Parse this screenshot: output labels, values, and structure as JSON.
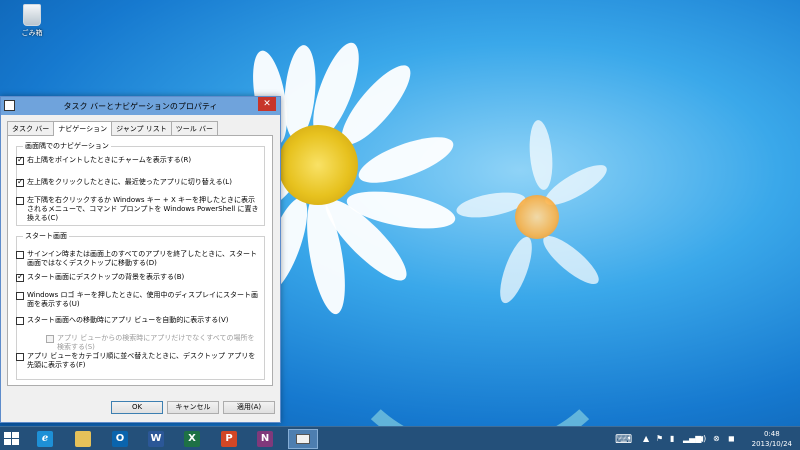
{
  "desktop": {
    "recycle_bin_label": "ごみ箱"
  },
  "dialog": {
    "title": "タスク バーとナビゲーションのプロパティ",
    "close_glyph": "✕",
    "tabs": [
      {
        "label": "タスク バー",
        "active": false
      },
      {
        "label": "ナビゲーション",
        "active": true
      },
      {
        "label": "ジャンプ リスト",
        "active": false
      },
      {
        "label": "ツール バー",
        "active": false
      }
    ],
    "corner_group": {
      "title": "画面隅でのナビゲーション",
      "options": [
        {
          "label": "右上隅をポイントしたときにチャームを表示する(R)",
          "checked": true
        },
        {
          "label": "左上隅をクリックしたときに、最近使ったアプリに切り替える(L)",
          "checked": true
        },
        {
          "label": "左下隅を右クリックするか Windows キー + X キーを押したときに表示されるメニューで、コマンド プロンプトを Windows PowerShell に置き換える(C)",
          "checked": false
        }
      ]
    },
    "start_group": {
      "title": "スタート画面",
      "options": [
        {
          "label": "サインイン時または画面上のすべてのアプリを終了したときに、スタート画面ではなくデスクトップに移動する(D)",
          "checked": false,
          "disabled": false
        },
        {
          "label": "スタート画面にデスクトップの背景を表示する(B)",
          "checked": true,
          "disabled": false
        },
        {
          "label": "Windows ロゴ キーを押したときに、使用中のディスプレイにスタート画面を表示する(U)",
          "checked": false,
          "disabled": false
        },
        {
          "label": "スタート画面への移動時にアプリ ビューを自動的に表示する(V)",
          "checked": false,
          "disabled": false
        },
        {
          "label": "アプリ ビューからの検索時にアプリだけでなくすべての場所を検索する(S)",
          "checked": false,
          "disabled": true
        },
        {
          "label": "アプリ ビューをカテゴリ順に並べ替えたときに、デスクトップ アプリを先頭に表示する(F)",
          "checked": false,
          "disabled": false
        }
      ]
    },
    "buttons": {
      "ok": "OK",
      "cancel": "キャンセル",
      "apply": "適用(A)"
    }
  },
  "taskbar": {
    "apps": [
      {
        "name": "internet-explorer",
        "glyph": "e",
        "color": "#1e90d6"
      },
      {
        "name": "file-explorer",
        "glyph": "",
        "color": "#e5c15a"
      },
      {
        "name": "outlook",
        "glyph": "O",
        "color": "#0a64ad"
      },
      {
        "name": "word",
        "glyph": "W",
        "color": "#2b5797"
      },
      {
        "name": "excel",
        "glyph": "X",
        "color": "#1e7145"
      },
      {
        "name": "powerpoint",
        "glyph": "P",
        "color": "#d24726"
      },
      {
        "name": "onenote",
        "glyph": "N",
        "color": "#80397b"
      }
    ],
    "tray": {
      "keyboard_glyph": "⌨",
      "signal_glyph": "📶",
      "volume_glyph": "🔊"
    },
    "clock": {
      "time": "0:48",
      "date": "2013/10/24"
    }
  }
}
